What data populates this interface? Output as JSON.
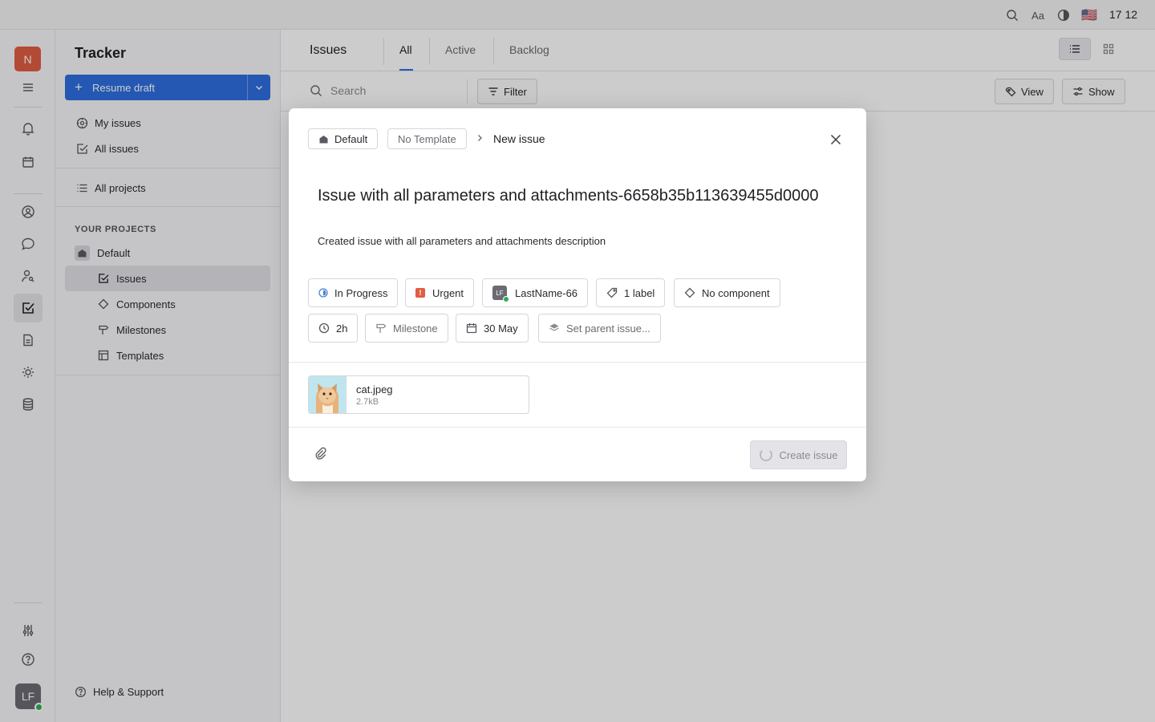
{
  "topbar": {
    "font_label": "Aa",
    "flag": "🇺🇸",
    "time": "17 12"
  },
  "rail": {
    "workspace_initial": "N",
    "user_initials": "LF"
  },
  "navigator": {
    "title": "Tracker",
    "resume_draft": "Resume draft",
    "my_issues": "My issues",
    "all_issues": "All issues",
    "all_projects": "All projects",
    "section_label": "YOUR PROJECTS",
    "project_name": "Default",
    "project_items": [
      "Issues",
      "Components",
      "Milestones",
      "Templates"
    ],
    "help": "Help & Support"
  },
  "main": {
    "title": "Issues",
    "tabs": [
      "All",
      "Active",
      "Backlog"
    ],
    "search_placeholder": "Search",
    "filter": "Filter",
    "view": "View",
    "show": "Show"
  },
  "modal": {
    "project": "Default",
    "template": "No Template",
    "crumb_current": "New issue",
    "title": "Issue with all parameters and attachments-6658b35b113639455d0000",
    "description": "Created issue with all parameters and attachments description",
    "status": "In Progress",
    "priority": "Urgent",
    "assignee": "LastName-66",
    "assignee_initials": "LF",
    "labels": "1 label",
    "component": "No component",
    "estimation": "2h",
    "milestone": "Milestone",
    "due_date": "30 May",
    "parent": "Set parent issue...",
    "attachment": {
      "name": "cat.jpeg",
      "size": "2.7kB"
    },
    "create_label": "Create issue"
  },
  "colors": {
    "accent": "#2d6fe0",
    "workspace": "#e05d44",
    "urgent": "#e05d44",
    "online": "#2cae56"
  },
  "icons": [
    "search-icon",
    "font-size-icon",
    "theme-icon",
    "flag-icon",
    "menu-icon",
    "bell-icon",
    "calendar-icon",
    "contacts-icon",
    "chat-icon",
    "recruit-icon",
    "tracker-icon",
    "documents-icon",
    "sun-icon",
    "database-icon",
    "settings-icon",
    "help-icon",
    "close-icon",
    "paperclip-icon"
  ]
}
